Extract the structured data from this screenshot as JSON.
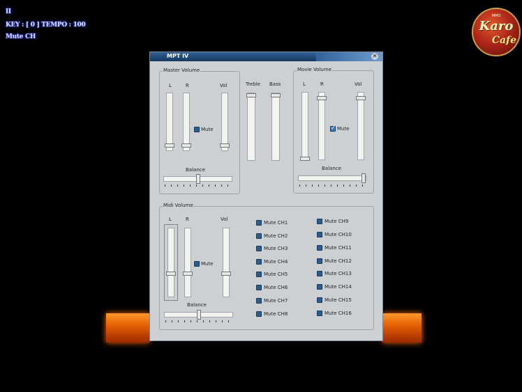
{
  "hud": {
    "indicator": "II",
    "key_tempo": "KEY : [ 0 ] TEMPO : 100",
    "status": "Mute CH"
  },
  "logo": {
    "small": "MMO",
    "line1": "Karo",
    "line2": "Cafe"
  },
  "window": {
    "title": "MPT IV",
    "close_icon": "close-icon"
  },
  "master": {
    "group_label": "Master Volume",
    "l": "L",
    "r": "R",
    "vol": "Vol",
    "mute": "Mute",
    "balance": "Balance",
    "levels": {
      "l": 0.15,
      "r": 0.15,
      "vol": 0.15
    },
    "mute_checked": false,
    "balance_value": 0.5
  },
  "tone": {
    "treble": "Treble",
    "bass": "Bass"
  },
  "movie": {
    "group_label": "Movie Volume",
    "l": "L",
    "r": "R",
    "vol": "Vol",
    "mute": "Mute",
    "balance": "Balance",
    "levels": {
      "l": 0.0,
      "r": 0.9,
      "vol": 0.9
    },
    "mute_checked": true,
    "balance_value": 1.0
  },
  "midi": {
    "group_label": "Midi Volume",
    "l": "L",
    "r": "R",
    "vol": "Vol",
    "mute": "Mute",
    "balance": "Balance",
    "channels_left": [
      "Mute CH1",
      "Mute CH2",
      "Mute CH3",
      "Mute CH4",
      "Mute CH5",
      "Mute CH6",
      "Mute CH7",
      "Mute CH8"
    ],
    "channels_right": [
      "Mute CH9",
      "Mute CH10",
      "Mute CH11",
      "Mute CH12",
      "Mute CH13",
      "Mute CH14",
      "Mute CH15",
      "Mute CH16"
    ]
  },
  "colors": {
    "accent": "#2a5e8c",
    "panel": "#ccd0d3",
    "glow": "#ff7a10"
  }
}
